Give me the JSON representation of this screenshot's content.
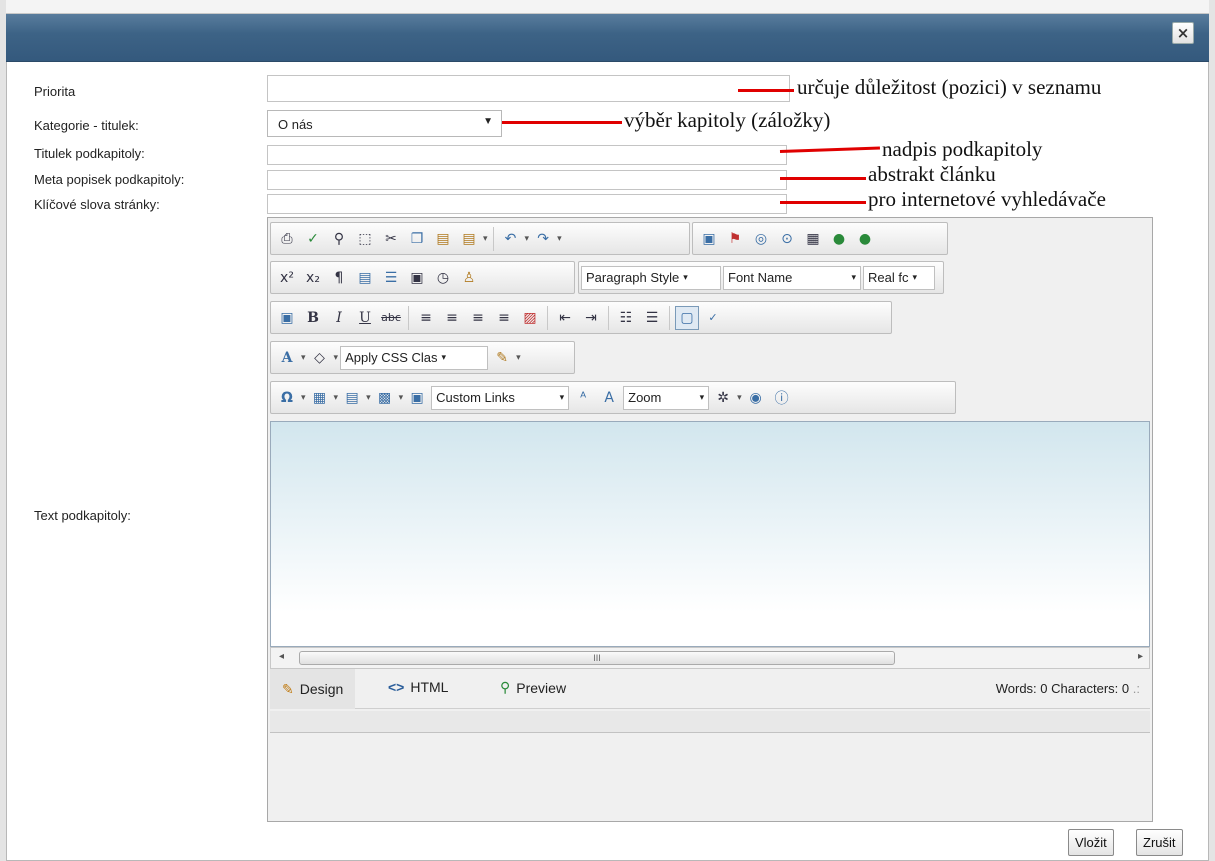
{
  "dialog": {
    "close_label": "×"
  },
  "fields": {
    "priorita": {
      "label": "Priorita",
      "value": ""
    },
    "kategorie": {
      "label": "Kategorie - titulek:",
      "value": "O nás"
    },
    "titulek": {
      "label": "Titulek podkapitoly:",
      "value": ""
    },
    "meta": {
      "label": "Meta popisek podkapitoly:",
      "value": ""
    },
    "klicove": {
      "label": "Klíčové slova stránky:",
      "value": ""
    },
    "text": {
      "label": "Text podkapitoly:"
    }
  },
  "annotations": [
    "určuje důležitost (pozici) v seznamu",
    "výběr kapitoly (záložky)",
    "nadpis podkapitoly",
    "abstrakt článku",
    "pro internetové vyhledávače"
  ],
  "toolbar": {
    "paragraph_style": "Paragraph Style",
    "font_name": "Font Name",
    "font_size": "Real fc",
    "apply_css": "Apply CSS Clas",
    "custom_links": "Custom Links",
    "zoom": "Zoom"
  },
  "editor": {
    "tab_design": "Design",
    "tab_html": "HTML",
    "tab_preview": "Preview",
    "status": "Words: 0  Characters: 0",
    "scroll_grip": "III"
  },
  "buttons": {
    "insert": "Vložit",
    "cancel": "Zrušit"
  },
  "colors": {
    "titlebar": "#3d6386",
    "annotation_line": "#e00000"
  }
}
